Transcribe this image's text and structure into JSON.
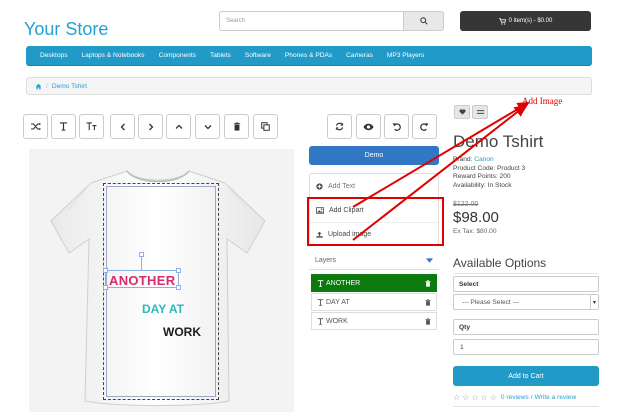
{
  "header": {
    "logo": "Your Store",
    "search_placeholder": "Search",
    "cart_label": "0 item(s) - $0.00"
  },
  "nav": {
    "items": [
      "Desktops",
      "Laptops & Notebooks",
      "Components",
      "Tablets",
      "Software",
      "Phones & PDAs",
      "Cameras",
      "MP3 Players"
    ]
  },
  "breadcrumb": {
    "current": "Demo Tshirt"
  },
  "toolbar": {
    "tools": [
      "shuffle-icon",
      "text-icon",
      "text-size-icon",
      "chevron-left-icon",
      "chevron-right-icon",
      "chevron-up-icon",
      "chevron-down-icon",
      "trash-icon",
      "copy-icon"
    ],
    "actions": [
      "refresh-icon",
      "eye-icon",
      "undo-icon",
      "redo-icon"
    ]
  },
  "canvas": {
    "text_lines": [
      "ANOTHER",
      "DAY AT",
      "WORK"
    ],
    "colors": {
      "another": "#d62c6b",
      "day_at": "#2bb9bf",
      "work": "#1c1c1c"
    }
  },
  "panel": {
    "demo_button": "Demo",
    "add_text": "Add Text",
    "add_clipart": "Add Clipart",
    "upload_image": "Upload image",
    "layers_title": "Layers",
    "layers": [
      "ANOTHER",
      "DAY AT",
      "WORK"
    ]
  },
  "product": {
    "title": "Demo Tshirt",
    "brand_label": "Brand:",
    "brand": "Canon",
    "product_code": "Product Code: Product 3",
    "reward_points": "Reward Points: 200",
    "availability": "Availability: In Stock",
    "old_price": "$122.00",
    "price": "$98.00",
    "ex_tax": "Ex Tax: $80.00"
  },
  "options": {
    "title": "Available Options",
    "select_label": "Select",
    "select_value": "--- Please Select ---",
    "qty_label": "Qty",
    "qty_value": "1",
    "add_to_cart": "Add to Cart",
    "reviews": "0 reviews",
    "separator": "/",
    "write_review": "Write a review"
  },
  "annotation": {
    "text": "Add Image",
    "color": "#e00000"
  }
}
